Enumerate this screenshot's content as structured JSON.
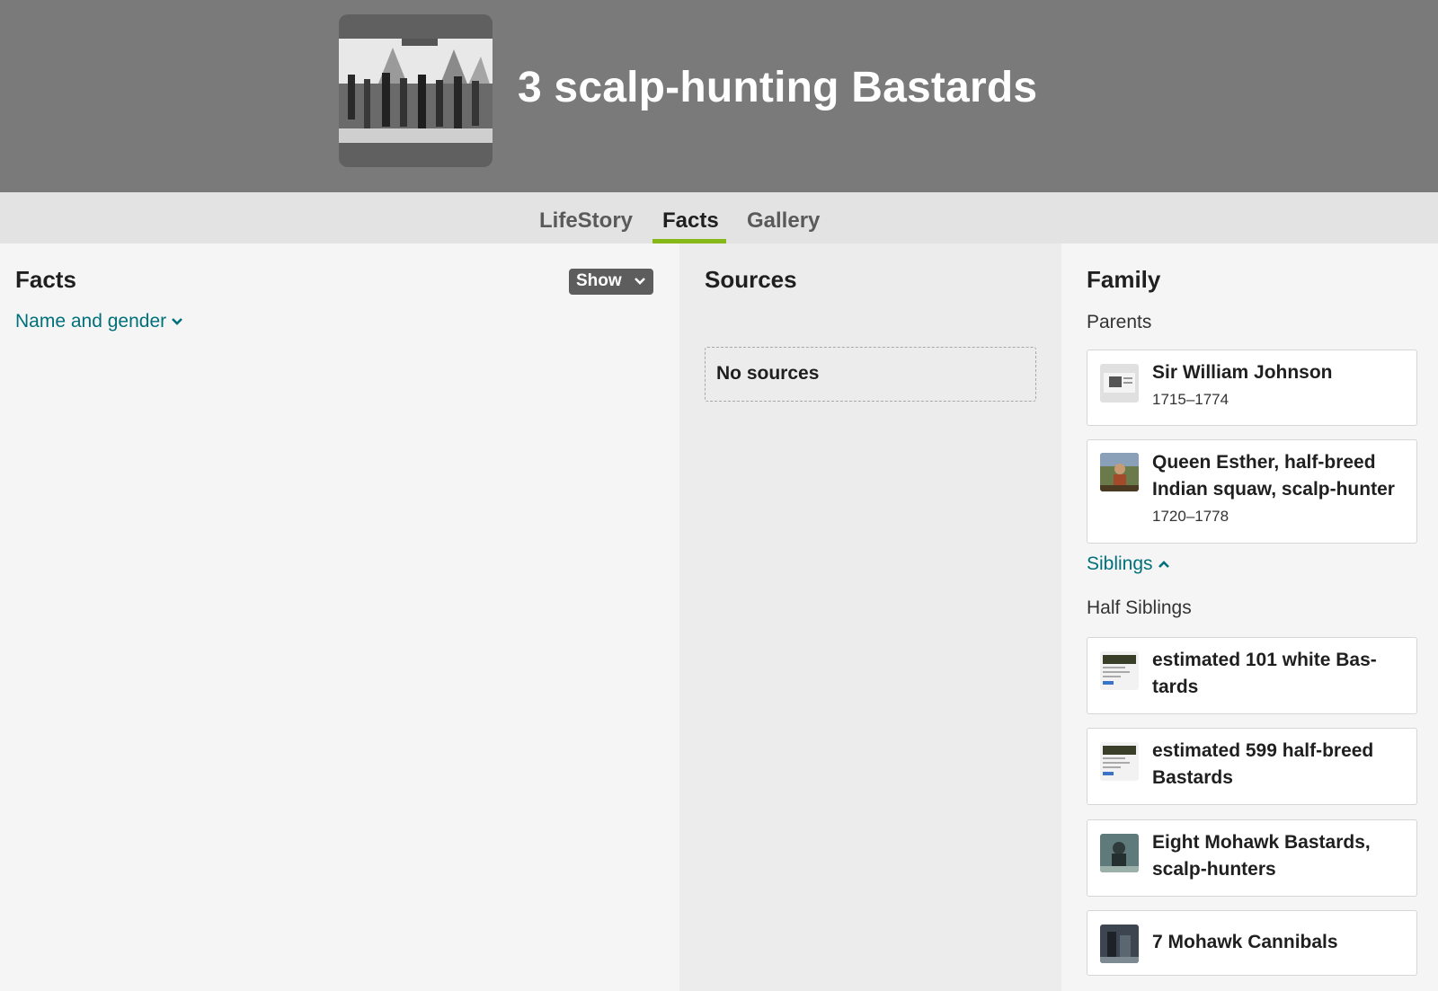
{
  "header": {
    "title": "3 scalp-hunting Bastards"
  },
  "tabs": [
    {
      "label": "LifeStory"
    },
    {
      "label": "Facts"
    },
    {
      "label": "Gallery"
    }
  ],
  "facts": {
    "title": "Facts",
    "show_label": "Show",
    "name_gender_link": "Name and gender"
  },
  "sources": {
    "title": "Sources",
    "empty_label": "No sources"
  },
  "family": {
    "title": "Family",
    "parents_label": "Parents",
    "parents": [
      {
        "name": "Sir William Johnson",
        "dates": "1715–1774"
      },
      {
        "name": "Queen Esther, half-breed Indian squaw, scalp-hunter",
        "dates": "1720–1778"
      }
    ],
    "siblings_link": "Siblings",
    "half_siblings_label": "Half Siblings",
    "half_siblings": [
      {
        "name": "estimated 101 white Bas-tards"
      },
      {
        "name": "estimated 599 half-breed Bastards"
      },
      {
        "name": "Eight Mohawk Bastards, scalp-hunters"
      },
      {
        "name": "7 Mohawk Cannibals"
      }
    ]
  },
  "colors": {
    "header_bg": "#7a7a7a",
    "tab_active_underline": "#86b817",
    "link": "#00707a"
  }
}
